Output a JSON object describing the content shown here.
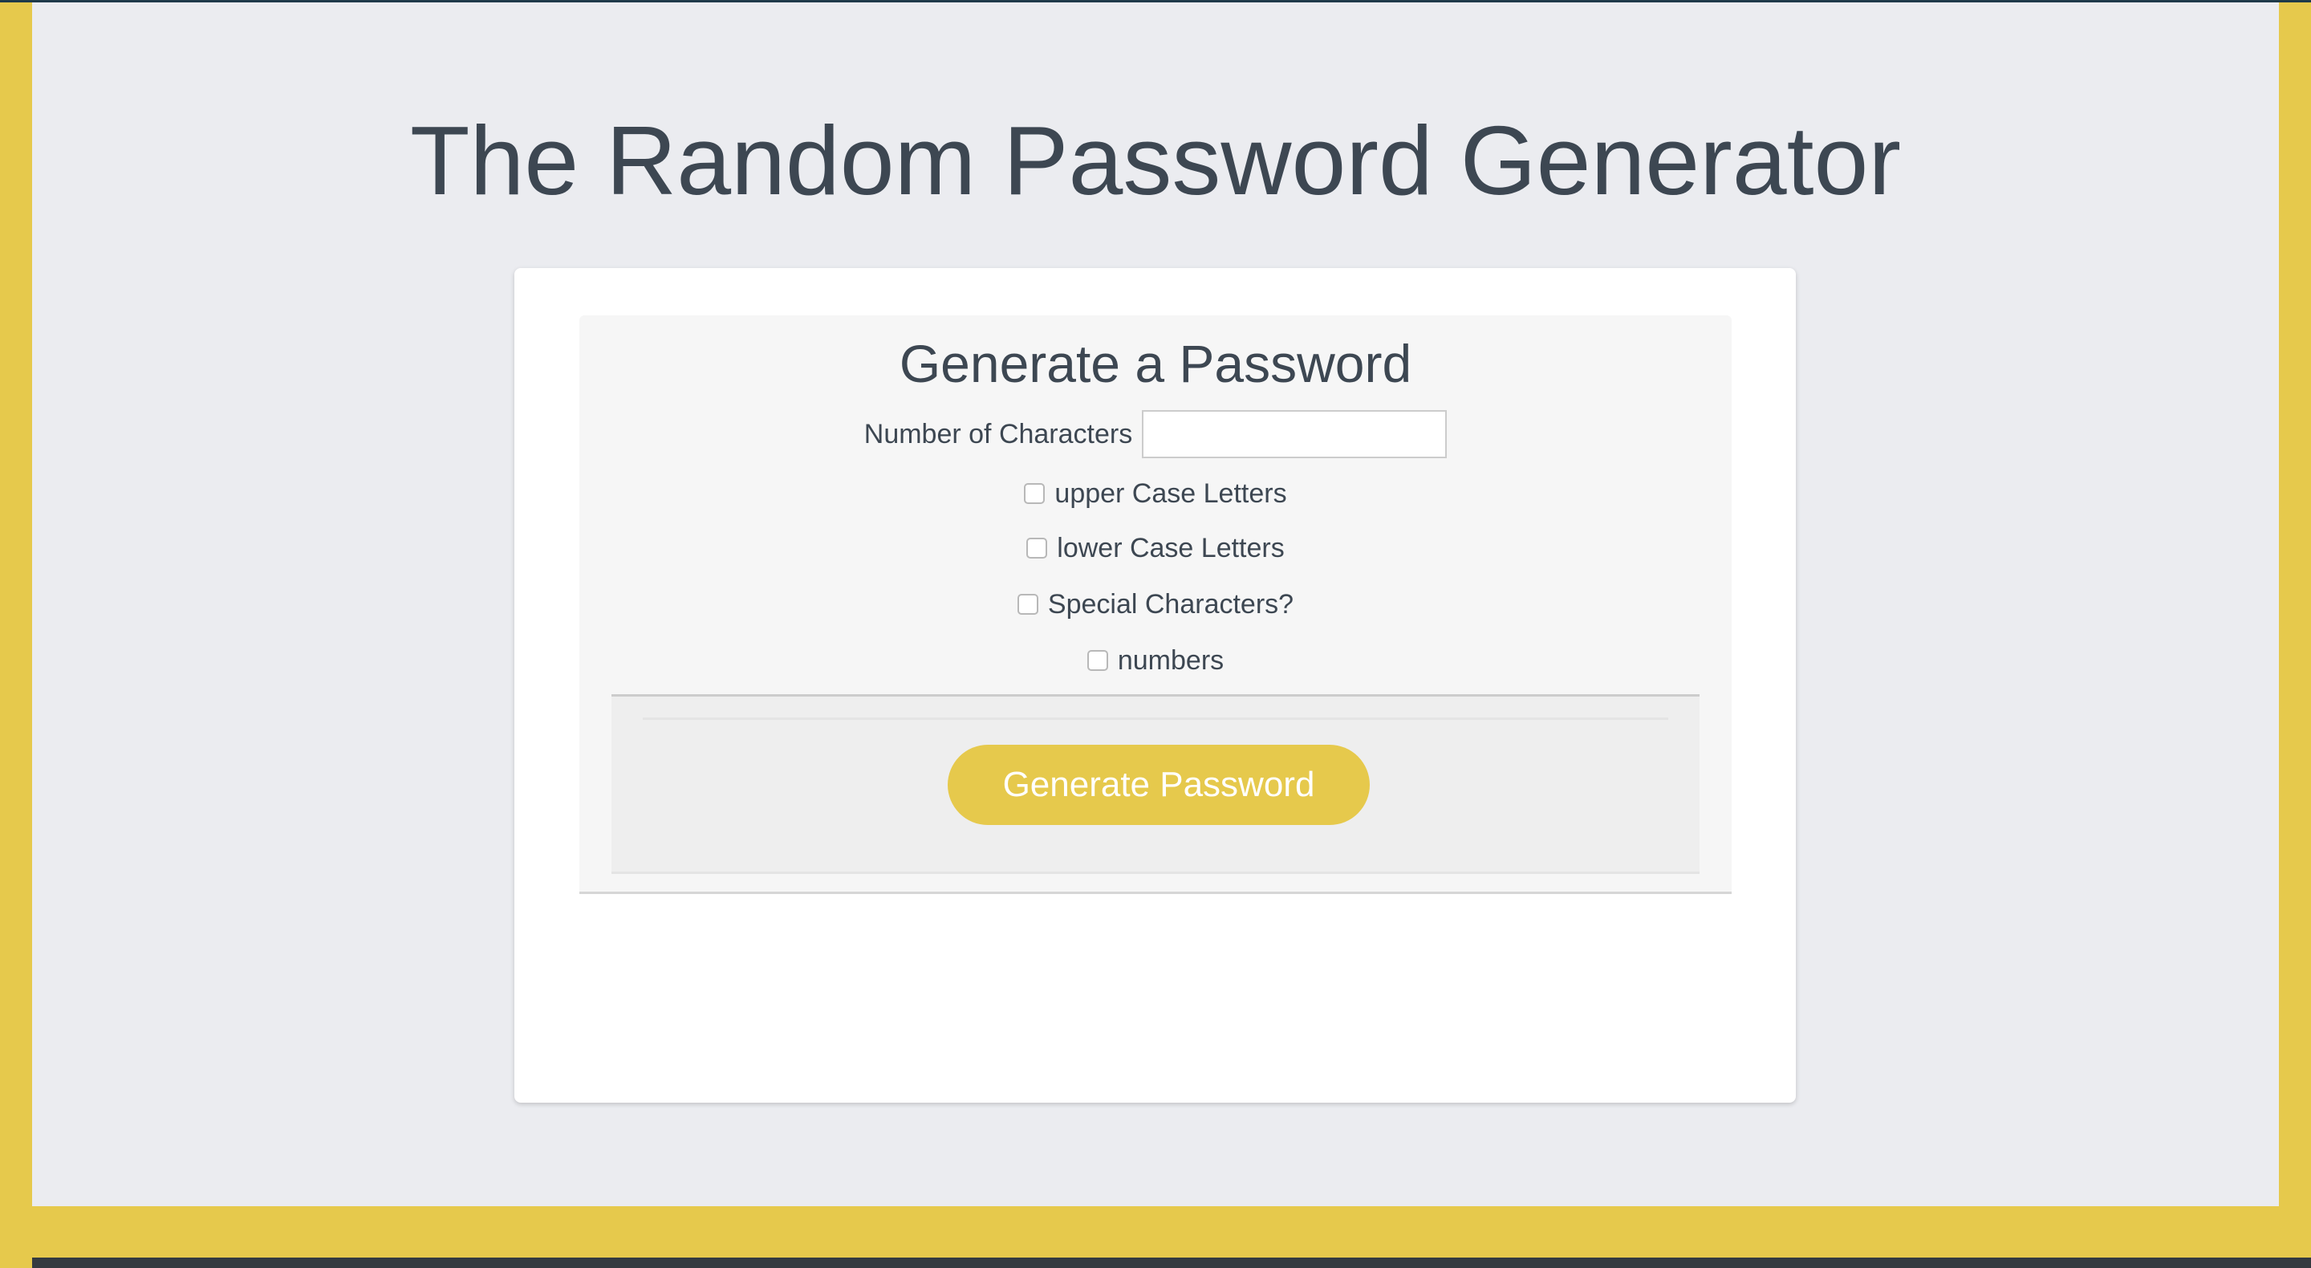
{
  "header": {
    "title": "The Random Password Generator"
  },
  "card": {
    "heading": "Generate a Password",
    "length_label": "Number of Characters",
    "length_value": "",
    "options": [
      {
        "label": "upper Case Letters",
        "checked": false
      },
      {
        "label": "lower Case Letters",
        "checked": false
      },
      {
        "label": "Special Characters?",
        "checked": false
      },
      {
        "label": "numbers",
        "checked": false
      }
    ],
    "generate_label": "Generate Password"
  },
  "colors": {
    "accent": "#e6c94c",
    "background": "#ebecf0",
    "text": "#3d4752",
    "footer": "#343a40"
  }
}
